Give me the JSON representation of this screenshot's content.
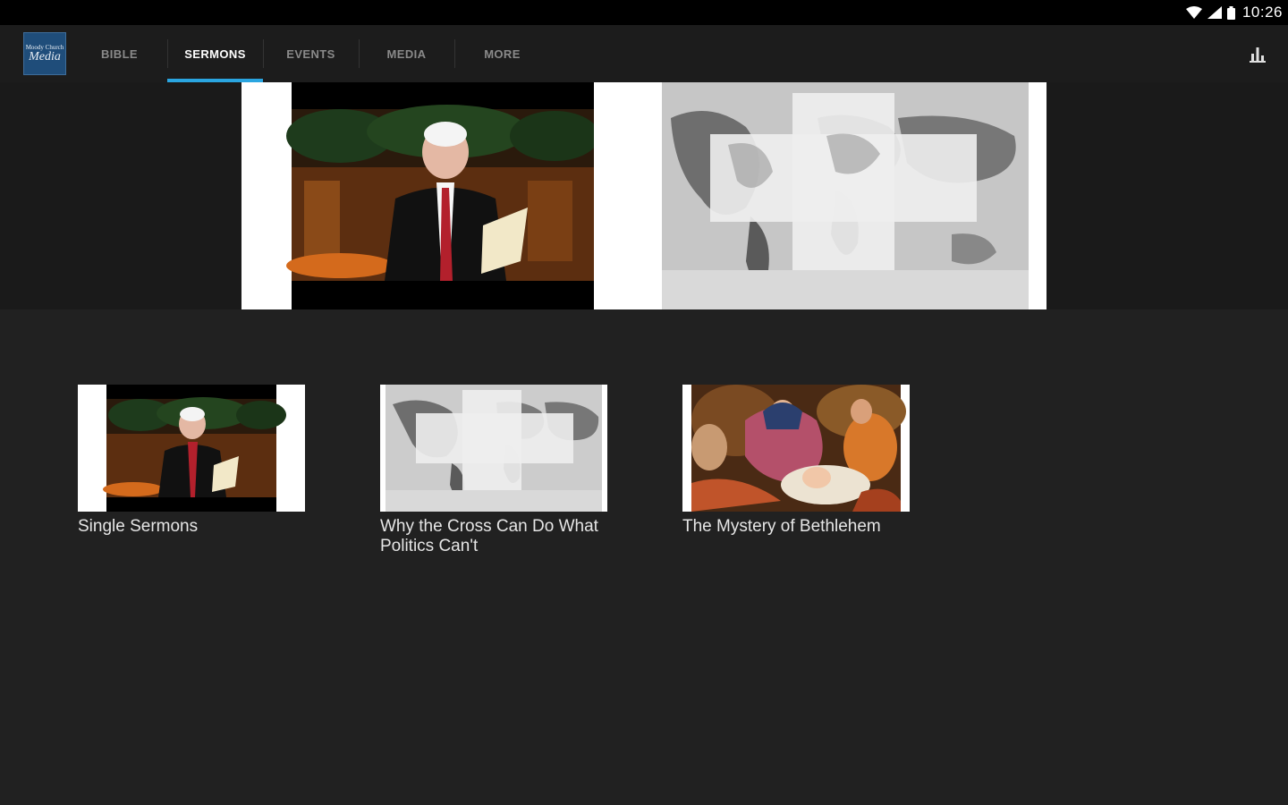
{
  "status_bar": {
    "time": "10:26"
  },
  "app_bar": {
    "logo": {
      "line1": "Moody Church",
      "line2": "Media"
    },
    "tabs": [
      {
        "label": "BIBLE",
        "active": false
      },
      {
        "label": "SERMONS",
        "active": true
      },
      {
        "label": "EVENTS",
        "active": false
      },
      {
        "label": "MEDIA",
        "active": false
      },
      {
        "label": "MORE",
        "active": false
      }
    ],
    "accent_color": "#2aa5e0"
  },
  "hero": {
    "slides": [
      {
        "image": "preacher-at-pulpit"
      },
      {
        "image": "world-map-cross"
      }
    ]
  },
  "sermon_series": [
    {
      "title": "Single Sermons",
      "image": "preacher-at-pulpit"
    },
    {
      "title": "Why the Cross Can Do What Politics Can't",
      "image": "world-map-cross"
    },
    {
      "title": "The Mystery of Bethlehem",
      "image": "nativity-painting"
    }
  ]
}
